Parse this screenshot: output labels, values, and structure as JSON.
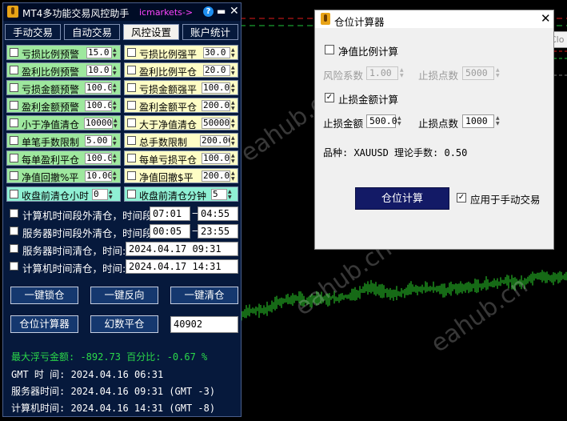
{
  "colors": {
    "panel_bg": "#06193c",
    "green_cell": "#9ee89e",
    "yellow_cell": "#fefdc5",
    "cyan_cell": "#8ff0d4",
    "loss_text": "#2bd84a",
    "calc_button": "#131a66",
    "broker_text": "#ff44ff"
  },
  "risk_panel": {
    "title": "MT4多功能交易风控助手",
    "broker": "icmarkets->",
    "tabs": [
      {
        "label": "手动交易"
      },
      {
        "label": "自动交易"
      },
      {
        "label": "风控设置"
      },
      {
        "label": "账户统计"
      }
    ],
    "rules_left": [
      {
        "label": "亏损比例预警",
        "value": "15.0"
      },
      {
        "label": "盈利比例预警",
        "value": "10.0"
      },
      {
        "label": "亏损金额预警",
        "value": "100.0"
      },
      {
        "label": "盈利金额预警",
        "value": "100.0"
      },
      {
        "label": "小于净值清仓",
        "value": "10000"
      },
      {
        "label": "单笔手数限制",
        "value": "5.00"
      },
      {
        "label": "每单盈利平仓",
        "value": "100.0"
      },
      {
        "label": "净值回撤%平",
        "value": "10.00"
      },
      {
        "label": "收盘前清仓小时",
        "value": "0"
      }
    ],
    "rules_right": [
      {
        "label": "亏损比例强平",
        "value": "30.0"
      },
      {
        "label": "盈利比例平仓",
        "value": "20.0"
      },
      {
        "label": "亏损金额强平",
        "value": "100.0"
      },
      {
        "label": "盈利金额平仓",
        "value": "200.0"
      },
      {
        "label": "大于净值清仓",
        "value": "50000"
      },
      {
        "label": "总手数限制",
        "value": "200.00"
      },
      {
        "label": "每单亏损平仓",
        "value": "100.0"
      },
      {
        "label": "净值回撤$平",
        "value": "200.0"
      },
      {
        "label": "收盘前清仓分钟",
        "value": "5"
      }
    ],
    "time_rules": [
      {
        "label": "计算机时间段外清仓，时间段",
        "from": "07:01",
        "to": "04:55"
      },
      {
        "label": "服务器时间段外清仓，时间段",
        "from": "00:05",
        "to": "23:55"
      },
      {
        "label": "服务器时间清仓，时间:",
        "datetime": "2024.04.17 09:31"
      },
      {
        "label": "计算机时间清仓，时间:",
        "datetime": "2024.04.17 14:31"
      }
    ],
    "buttons": {
      "lock": "一键锁仓",
      "reverse": "一键反向",
      "close_all": "一键清仓",
      "position_calc": "仓位计算器",
      "magic_close": "幻数平仓"
    },
    "magic_number": "40902",
    "max_float_loss": "最大浮亏金额:  -892.73 百分比: -0.67 %",
    "gmt_time": " GMT 时 间: 2024.04.16 06:31",
    "server_time": "服务器时间: 2024.04.16 09:31 (GMT -3)",
    "computer_time": "计算机时间: 2024.04.16 14:31 (GMT -8)"
  },
  "calc_dialog": {
    "title": "仓位计算器",
    "equity_ratio_label": "净值比例计算",
    "risk_factor_label": "风险系数",
    "risk_factor_value": "1.00",
    "stop_points_label": "止损点数",
    "stop_points_value_disabled": "5000",
    "stop_amount_section_label": "止损金额计算",
    "stop_amount_label": "止损金额",
    "stop_amount_value": "500.0",
    "stop_points_value": "1000",
    "symbol_line": "品种:  XAUUSD   理论手数: 0.50",
    "calc_button": "仓位计算",
    "apply_manual_label": "应用于手动交易",
    "check_mark": "✓"
  },
  "background": {
    "close_peek": "Clo",
    "watermark": "eahub.cn"
  }
}
